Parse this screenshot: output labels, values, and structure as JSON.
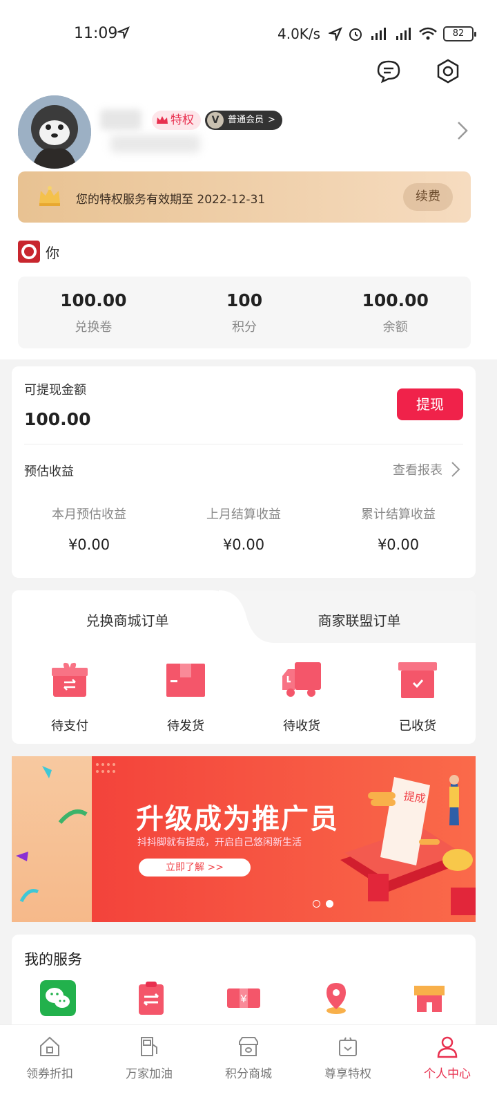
{
  "status_bar": {
    "time": "11:09",
    "network_speed": "4.0K/s",
    "battery": "82"
  },
  "profile": {
    "privilege_tag": "特权",
    "member_tag": "普通会员",
    "member_tag_arrow": ">"
  },
  "privilege_banner": {
    "text": "您的特权服务有效期至 2022-12-31",
    "renew_label": "续费"
  },
  "shop": {
    "name": "你"
  },
  "stats": [
    {
      "value": "100.00",
      "label": "兑换卷"
    },
    {
      "value": "100",
      "label": "积分"
    },
    {
      "value": "100.00",
      "label": "余额"
    }
  ],
  "withdraw": {
    "label": "可提现金额",
    "amount": "100.00",
    "button": "提现",
    "estimate_label": "预估收益",
    "report_link": "查看报表",
    "earnings": [
      {
        "label": "本月预估收益",
        "value": "¥0.00"
      },
      {
        "label": "上月结算收益",
        "value": "¥0.00"
      },
      {
        "label": "累计结算收益",
        "value": "¥0.00"
      }
    ]
  },
  "orders": {
    "tabs": [
      "兑换商城订单",
      "商家联盟订单"
    ],
    "items": [
      {
        "label": "待支付",
        "icon": "gift-box-icon"
      },
      {
        "label": "待发货",
        "icon": "package-icon"
      },
      {
        "label": "待收货",
        "icon": "truck-icon"
      },
      {
        "label": "已收货",
        "icon": "box-check-icon"
      }
    ]
  },
  "banner": {
    "title": "升级成为推广员",
    "subtitle": "抖抖脚就有提成，开启自己悠闲新生活",
    "cta": "立即了解 >>",
    "receipt_text": "提成"
  },
  "services": {
    "title": "我的服务"
  },
  "nav": [
    {
      "label": "领券折扣",
      "icon": "home-icon"
    },
    {
      "label": "万家加油",
      "icon": "fuel-icon"
    },
    {
      "label": "积分商城",
      "icon": "store-icon"
    },
    {
      "label": "尊享特权",
      "icon": "privilege-bag-icon"
    },
    {
      "label": "个人中心",
      "icon": "person-icon"
    }
  ],
  "colors": {
    "accent": "#e8304f",
    "withdraw_button": "#f0224a",
    "privilege_bar": "#e8c292"
  }
}
